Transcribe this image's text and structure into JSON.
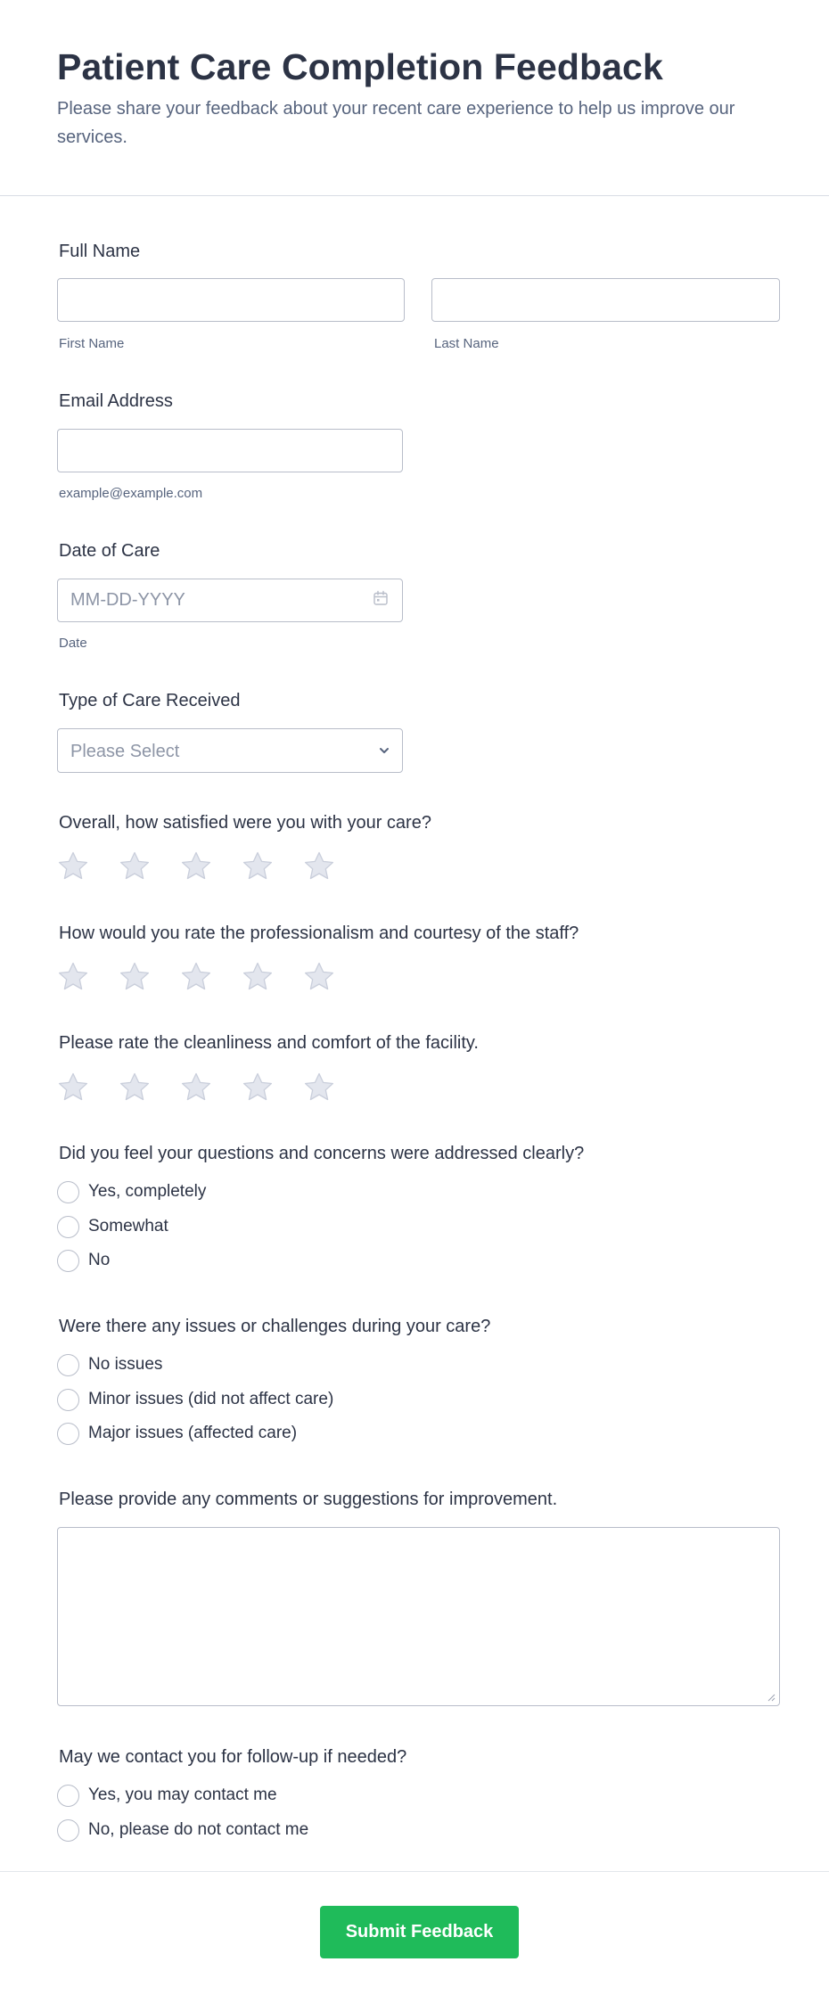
{
  "header": {
    "title": "Patient Care Completion Feedback",
    "subtitle": "Please share your feedback about your recent care experience to help us improve our services."
  },
  "full_name": {
    "label": "Full Name",
    "first": {
      "value": "",
      "sublabel": "First Name"
    },
    "last": {
      "value": "",
      "sublabel": "Last Name"
    }
  },
  "email": {
    "label": "Email Address",
    "value": "",
    "sublabel": "example@example.com"
  },
  "date_of_care": {
    "label": "Date of Care",
    "placeholder": "MM-DD-YYYY",
    "sublabel": "Date",
    "icon": "calendar-icon"
  },
  "care_type": {
    "label": "Type of Care Received",
    "selected": "Please Select",
    "icon": "chevron-down-icon"
  },
  "ratings": [
    {
      "question": "Overall, how satisfied were you with your care?",
      "stars": 5,
      "selected": 0
    },
    {
      "question": "How would you rate the professionalism and courtesy of the staff?",
      "stars": 5,
      "selected": 0
    },
    {
      "question": "Please rate the cleanliness and comfort of the facility.",
      "stars": 5,
      "selected": 0
    }
  ],
  "questions_addressed": {
    "label": "Did you feel your questions and concerns were addressed clearly?",
    "options": [
      "Yes, completely",
      "Somewhat",
      "No"
    ]
  },
  "issues": {
    "label": "Were there any issues or challenges during your care?",
    "options": [
      "No issues",
      "Minor issues (did not affect care)",
      "Major issues (affected care)"
    ]
  },
  "comments": {
    "label": "Please provide any comments or suggestions for improvement.",
    "value": ""
  },
  "contact": {
    "label": "May we contact you for follow-up if needed?",
    "options": [
      "Yes, you may contact me",
      "No, please do not contact me"
    ]
  },
  "submit": {
    "label": "Submit Feedback"
  },
  "colors": {
    "accent_green": "#1fbb5a",
    "text_dark": "#2c3345",
    "text_muted": "#57647e",
    "border": "#b8bdc9",
    "star_fill": "#e3e6ee",
    "star_stroke": "#c9cedb"
  }
}
